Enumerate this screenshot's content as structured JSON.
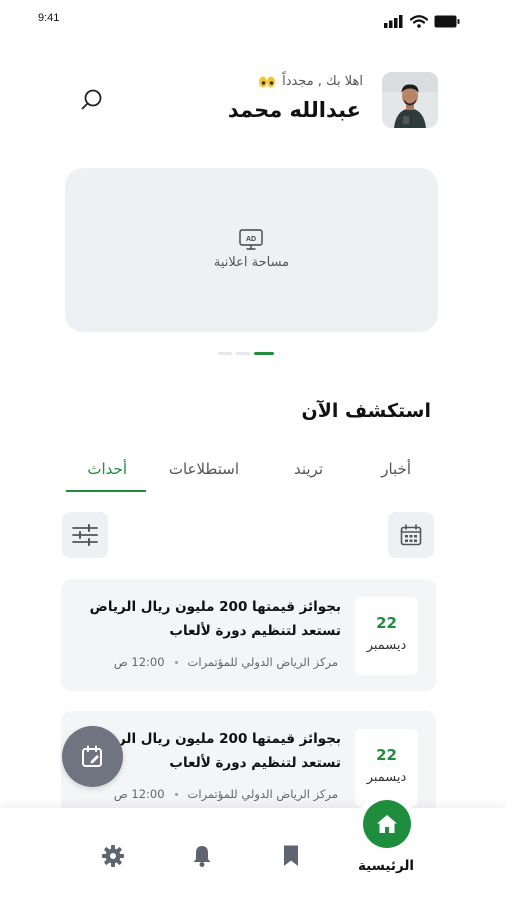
{
  "status_bar": {
    "time": "9:41"
  },
  "header": {
    "greeting": "اهلا بك , مجدداً",
    "username": "عبدالله محمد"
  },
  "ad": {
    "label": "مساحة اعلانية",
    "icon_text": "AD"
  },
  "explore": {
    "title": "استكشف الآن",
    "tabs": [
      {
        "label": "أخبار",
        "active": false
      },
      {
        "label": "تريند",
        "active": false
      },
      {
        "label": "استطلاعات",
        "active": false
      },
      {
        "label": "أحداث",
        "active": true
      }
    ]
  },
  "events": [
    {
      "day": "22",
      "month": "ديسمبر",
      "title": "بجوائز قيمتها 200 مليون ريال الرياض تستعد لتنظيم دورة لألعاب",
      "location": "مركز الرياض الدولي للمؤتمرات",
      "time": "12:00 ص"
    },
    {
      "day": "22",
      "month": "ديسمبر",
      "title": "بجوائز قيمتها 200 مليون ريال الرياض تستعد لتنظيم دورة لألعاب",
      "location": "مركز الرياض الدولي للمؤتمرات",
      "time": "12:00 ص"
    }
  ],
  "bottom_nav": {
    "home_label": "الرئيسية",
    "items": [
      "home-icon",
      "bookmark-icon",
      "bell-icon",
      "gear-icon"
    ]
  },
  "colors": {
    "accent": "#1e8e3e",
    "card_bg": "#f4f5f7",
    "fab": "#6f7480"
  }
}
